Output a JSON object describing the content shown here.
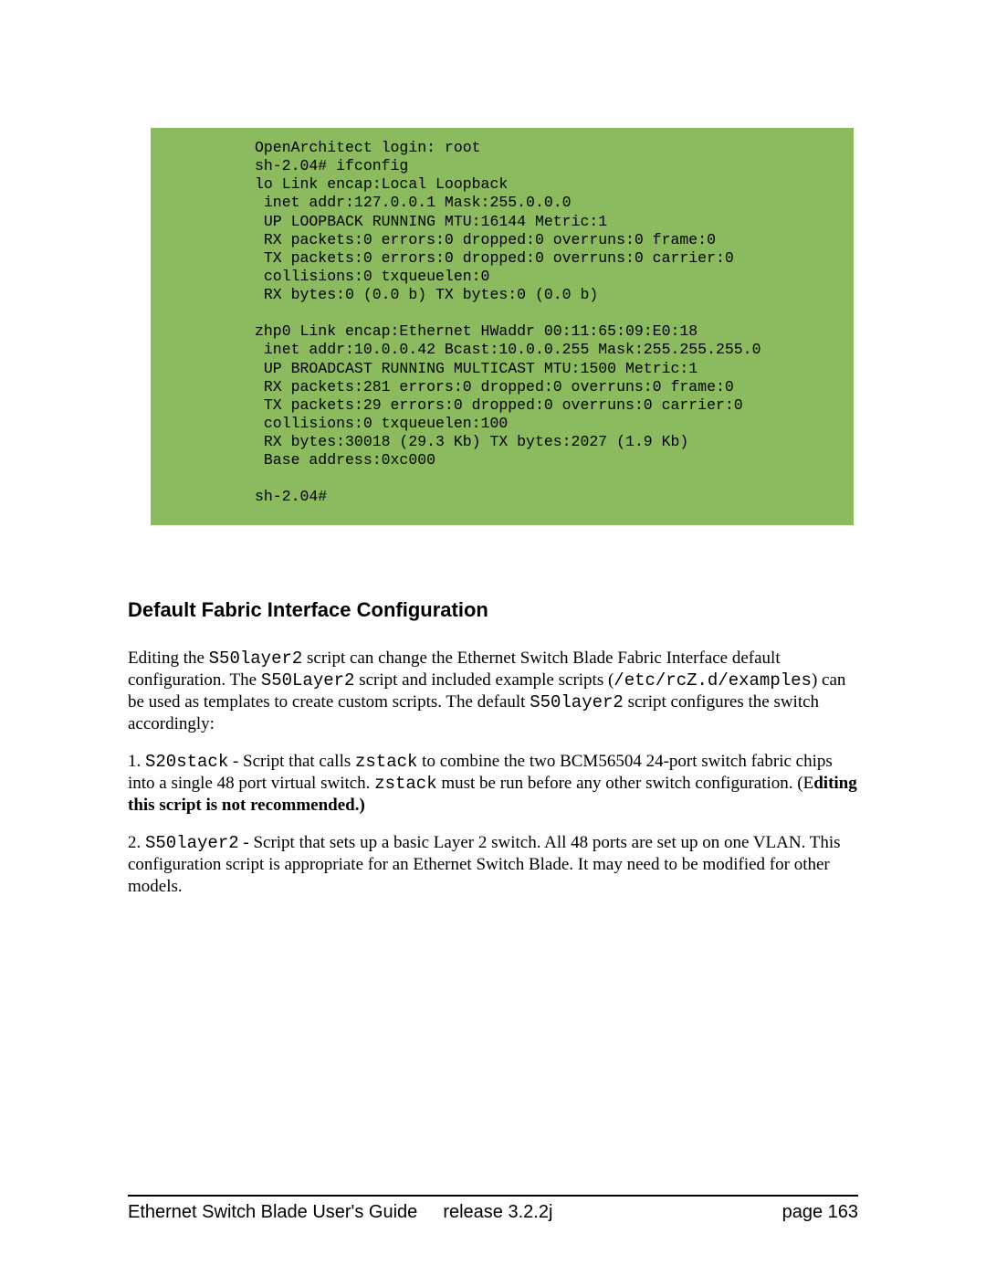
{
  "code": "OpenArchitect login: root\nsh-2.04# ifconfig\nlo Link encap:Local Loopback\n inet addr:127.0.0.1 Mask:255.0.0.0\n UP LOOPBACK RUNNING MTU:16144 Metric:1\n RX packets:0 errors:0 dropped:0 overruns:0 frame:0\n TX packets:0 errors:0 dropped:0 overruns:0 carrier:0\n collisions:0 txqueuelen:0\n RX bytes:0 (0.0 b) TX bytes:0 (0.0 b)\n\nzhp0 Link encap:Ethernet HWaddr 00:11:65:09:E0:18\n inet addr:10.0.0.42 Bcast:10.0.0.255 Mask:255.255.255.0\n UP BROADCAST RUNNING MULTICAST MTU:1500 Metric:1\n RX packets:281 errors:0 dropped:0 overruns:0 frame:0\n TX packets:29 errors:0 dropped:0 overruns:0 carrier:0\n collisions:0 txqueuelen:100\n RX bytes:30018 (29.3 Kb) TX bytes:2027 (1.9 Kb)\n Base address:0xc000\n\nsh-2.04#",
  "heading": "Default Fabric Interface Configuration",
  "para1": {
    "t1": "Editing the ",
    "s50a": "S50layer2",
    "t2": " script can change the Ethernet Switch Blade Fabric Interface default configuration. The ",
    "s50b": "S50Layer2",
    "t3": " script and included example scripts (",
    "path": "/etc/rcZ.d/examples",
    "t4": ") can be used as templates to create custom scripts. The default ",
    "s50c": "S50layer2",
    "t5": " script configures the switch accordingly:"
  },
  "para2": {
    "t1": "1. ",
    "s20": "S20stack",
    "t2": " - Script that calls ",
    "zstack1": "zstack",
    "t3": "  to combine the two BCM56504 24-port switch fabric chips into a single 48 port virtual switch. ",
    "zstack2": "zstack",
    "t4": " must be run before any other switch configuration. (E",
    "bold": "diting this script is not recommended.)"
  },
  "para3": {
    "t1": "2. ",
    "s50": "S50layer2",
    "t2": " - Script that sets up a basic Layer 2 switch. All 48 ports are set up on one VLAN. This configuration script is appropriate for an Ethernet Switch Blade. It may need to be modified for other models."
  },
  "footer": {
    "left": "Ethernet Switch Blade User's Guide",
    "center": "release  3.2.2j",
    "right": "page 163"
  }
}
